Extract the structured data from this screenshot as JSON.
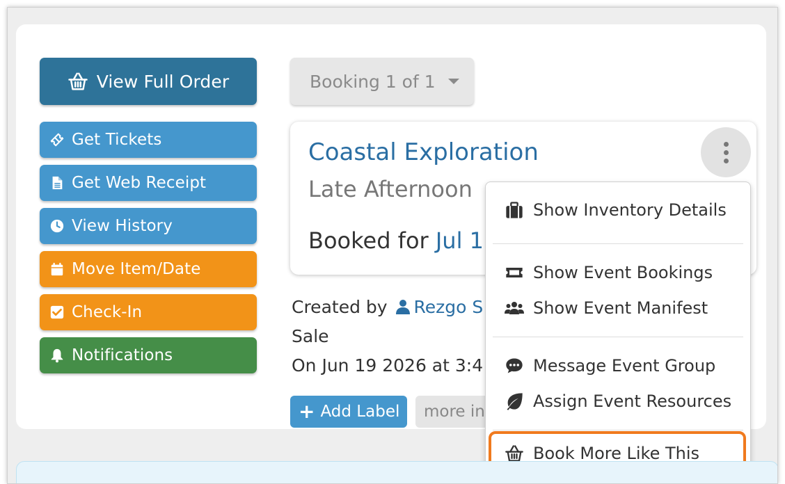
{
  "left_buttons": {
    "view_full_order": "View Full Order",
    "get_tickets": "Get Tickets",
    "get_web_receipt": "Get Web Receipt",
    "view_history": "View History",
    "move_item_date": "Move Item/Date",
    "check_in": "Check-In",
    "notifications": "Notifications"
  },
  "booking_select": {
    "value": "Booking 1 of 1"
  },
  "item": {
    "title": "Coastal Exploration",
    "subtitle": "Late Afternoon",
    "booked_prefix": "Booked for",
    "booked_date": "Jul 1"
  },
  "created": {
    "prefix": "Created by",
    "user": "Rezgo S",
    "sale": "Sale",
    "on": "On Jun 19 2026 at 3:4"
  },
  "labels": {
    "add_label": "Add Label",
    "more_info": "more info"
  },
  "menu": {
    "items": [
      {
        "label": "Show Inventory Details",
        "icon": "briefcase-icon"
      },
      {
        "label": "Show Event Bookings",
        "icon": "ticket-icon"
      },
      {
        "label": "Show Event Manifest",
        "icon": "users-icon"
      },
      {
        "label": "Message Event Group",
        "icon": "comment-icon"
      },
      {
        "label": "Assign Event Resources",
        "icon": "leaf-icon"
      },
      {
        "label": "Book More Like This",
        "icon": "basket-icon"
      }
    ]
  },
  "colors": {
    "primary": "#2e7399",
    "blue": "#4597cd",
    "orange": "#f29318",
    "green": "#458e48",
    "link": "#2a6ea3",
    "highlight": "#f07a1e"
  }
}
